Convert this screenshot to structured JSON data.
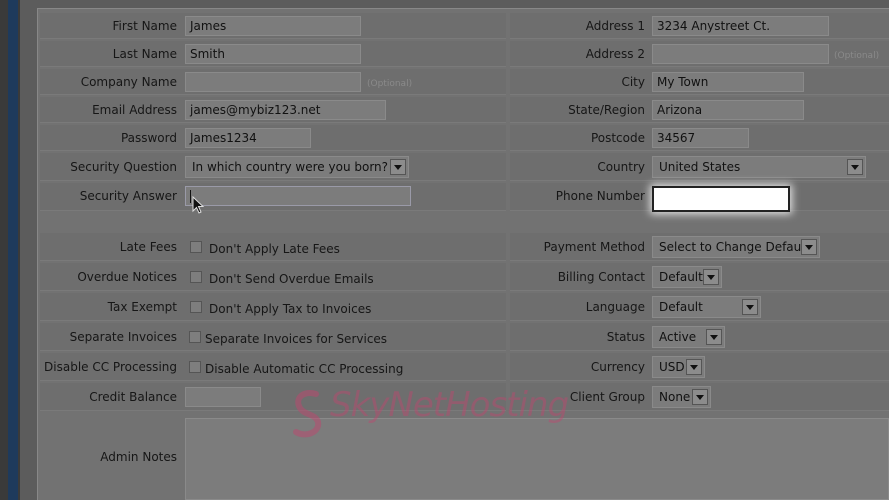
{
  "left_column": {
    "first_name": {
      "label": "First Name",
      "value": "James"
    },
    "last_name": {
      "label": "Last Name",
      "value": "Smith"
    },
    "company_name": {
      "label": "Company Name",
      "value": "",
      "hint": "(Optional)"
    },
    "email": {
      "label": "Email Address",
      "value": "james@mybiz123.net"
    },
    "password": {
      "label": "Password",
      "value": "James1234"
    },
    "security_question": {
      "label": "Security Question",
      "value": "In which country were you born?"
    },
    "security_answer": {
      "label": "Security Answer",
      "value": ""
    },
    "late_fees": {
      "label": "Late Fees",
      "option": "Don't Apply Late Fees"
    },
    "overdue_notices": {
      "label": "Overdue Notices",
      "option": "Don't Send Overdue Emails"
    },
    "tax_exempt": {
      "label": "Tax Exempt",
      "option": "Don't Apply Tax to Invoices"
    },
    "separate_invoices": {
      "label": "Separate Invoices",
      "option": "Separate Invoices for Services"
    },
    "disable_cc": {
      "label": "Disable CC Processing",
      "option": "Disable Automatic CC Processing"
    },
    "credit_balance": {
      "label": "Credit Balance",
      "value": ""
    },
    "admin_notes": {
      "label": "Admin Notes",
      "value": ""
    }
  },
  "right_column": {
    "address1": {
      "label": "Address 1",
      "value": "3234 Anystreet Ct."
    },
    "address2": {
      "label": "Address 2",
      "value": "",
      "hint": "(Optional)"
    },
    "city": {
      "label": "City",
      "value": "My Town"
    },
    "state": {
      "label": "State/Region",
      "value": "Arizona"
    },
    "postcode": {
      "label": "Postcode",
      "value": "34567"
    },
    "country": {
      "label": "Country",
      "value": "United States"
    },
    "phone": {
      "label": "Phone Number",
      "value": ""
    },
    "payment_method": {
      "label": "Payment Method",
      "value": "Select to Change Default"
    },
    "billing_contact": {
      "label": "Billing Contact",
      "value": "Default"
    },
    "language": {
      "label": "Language",
      "value": "Default"
    },
    "status": {
      "label": "Status",
      "value": "Active"
    },
    "currency": {
      "label": "Currency",
      "value": "USD"
    },
    "client_group": {
      "label": "Client Group",
      "value": "None"
    }
  },
  "watermark": {
    "text": "SkyNetHosting",
    "color": "#be466e"
  }
}
